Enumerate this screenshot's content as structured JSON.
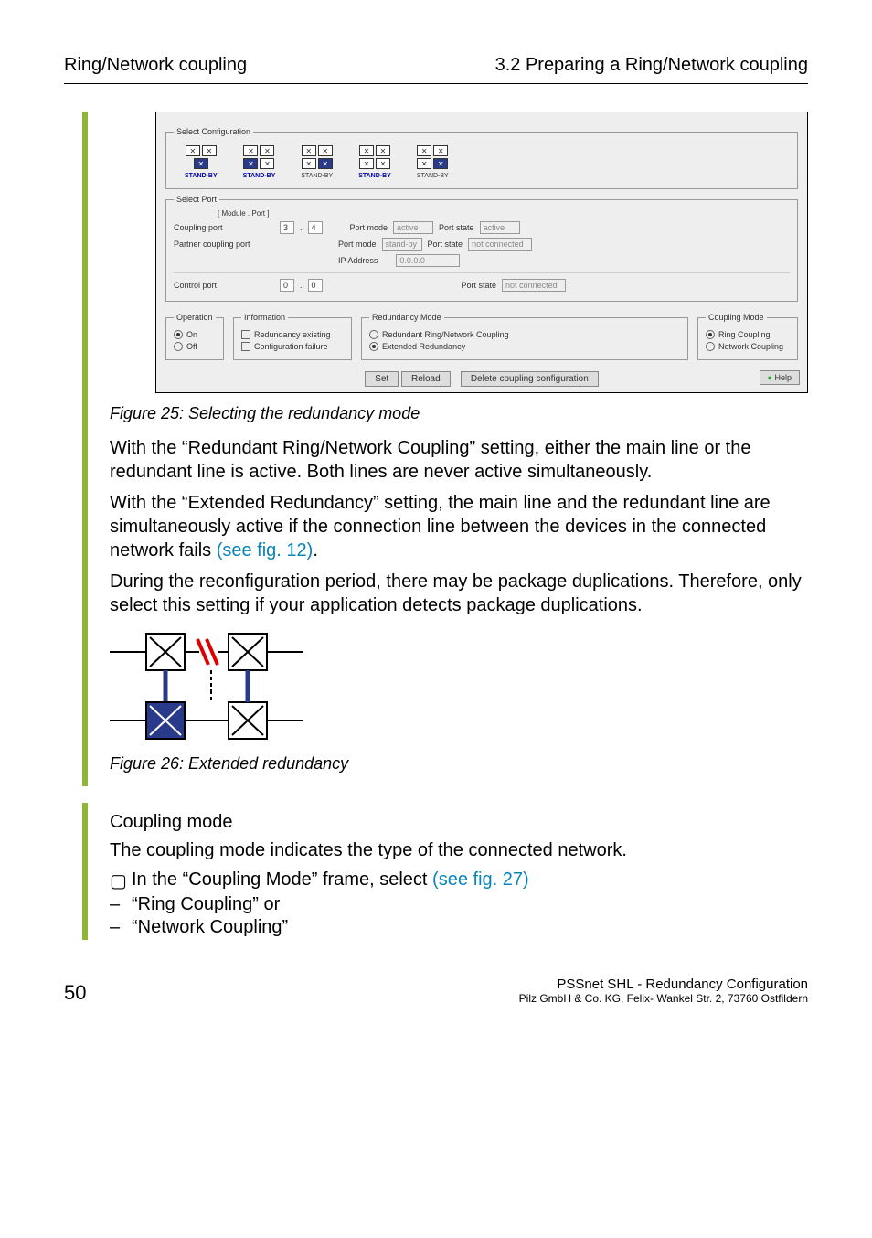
{
  "header": {
    "left": "Ring/Network coupling",
    "right": "3.2  Preparing a Ring/Network coupling"
  },
  "screenshot": {
    "select_config_legend": "Select Configuration",
    "select_port_legend": "Select Port",
    "module_port_label": "[ Module . Port ]",
    "coupling_port_label": "Coupling port",
    "coupling_module": "3",
    "coupling_port": "4",
    "port_mode_label": "Port mode",
    "port_state_label": "Port state",
    "port_mode_active": "active",
    "port_state_active": "active",
    "partner_label": "Partner coupling port",
    "port_mode_standby": "stand-by",
    "port_state_notconn": "not connected",
    "ip_label": "IP Address",
    "ip_value": "0.0.0.0",
    "control_label": "Control port",
    "control_module": "0",
    "control_port": "0",
    "operation_legend": "Operation",
    "on": "On",
    "off": "Off",
    "info_legend": "Information",
    "info_redex": "Redundancy existing",
    "info_cfgfail": "Configuration failure",
    "redmode_legend": "Redundancy Mode",
    "redmode_rnc": "Redundant Ring/Network Coupling",
    "redmode_ext": "Extended Redundancy",
    "cmode_legend": "Coupling Mode",
    "cmode_ring": "Ring Coupling",
    "cmode_net": "Network Coupling",
    "btn_set": "Set",
    "btn_reload": "Reload",
    "btn_delete": "Delete coupling configuration",
    "btn_help": "Help",
    "standby": "STAND-BY"
  },
  "figure25": {
    "caption": "Figure 25: Selecting the redundancy mode"
  },
  "para1": "With the “Redundant Ring/Network Coupling” setting, either the main line or the redundant line is active. Both lines are never active simultaneously.",
  "para2a": "With the “Extended Redundancy” setting, the main line and the redundant line are simultaneously active if the connection line between the devices in the connected network fails ",
  "para2b": "(see fig. 12)",
  "para2c": ".",
  "para3": "During the reconfiguration period, there may be package duplications. Therefore, only select this setting if your application detects package duplications.",
  "figure26": {
    "caption": "Figure 26: Extended redundancy"
  },
  "coupling_heading": "Coupling mode",
  "coupling_intro": "The coupling mode indicates the type of the connected network.",
  "coupling_select_a": "In the “Coupling Mode” frame, select ",
  "coupling_select_b": "(see fig. 27)",
  "coupling_opt1": "“Ring Coupling” or",
  "coupling_opt2": "“Network Coupling”",
  "footer": {
    "page": "50",
    "title": "PSSnet SHL - Redundancy Configuration",
    "company": "Pilz GmbH & Co. KG, Felix- Wankel Str. 2, 73760 Ostfildern"
  }
}
